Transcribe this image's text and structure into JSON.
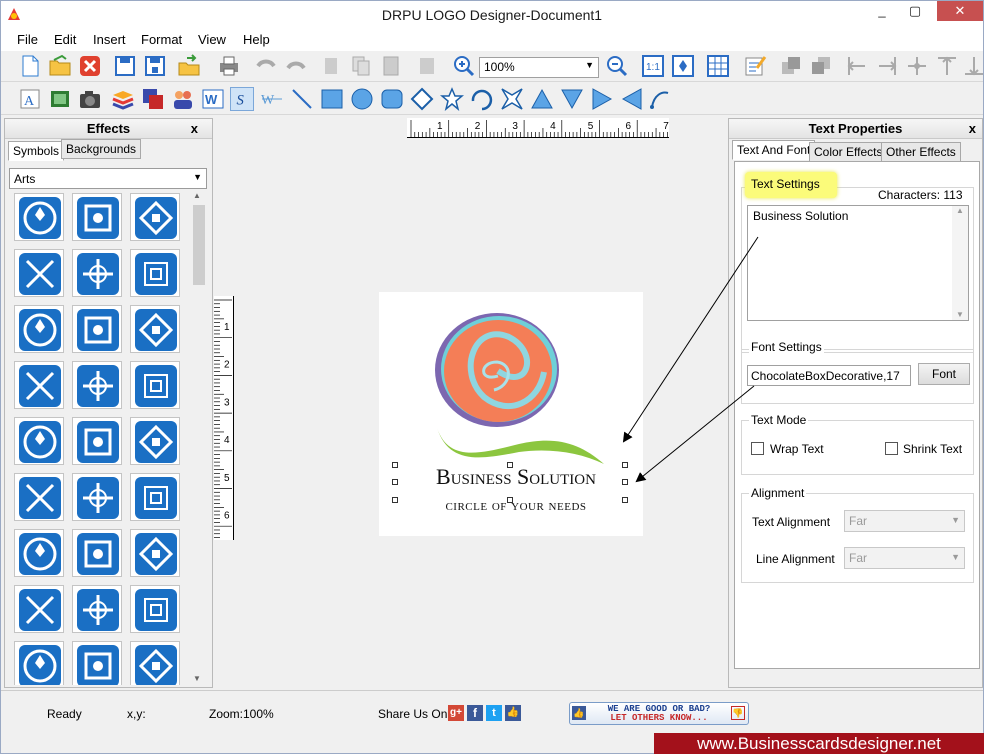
{
  "window": {
    "title": "DRPU LOGO Designer-Document1",
    "min": "_",
    "restore": "▢",
    "close": "✕"
  },
  "menu": [
    "File",
    "Edit",
    "Insert",
    "Format",
    "View",
    "Help"
  ],
  "toolbar": {
    "zoom_value": "100%"
  },
  "effects": {
    "title": "Effects",
    "close": "x",
    "tabs": [
      "Symbols",
      "Backgrounds"
    ],
    "category": "Arts"
  },
  "ruler": {
    "h_ticks": [
      "1",
      "2",
      "3",
      "4",
      "5",
      "6",
      "7"
    ],
    "v_ticks": [
      "1",
      "2",
      "3",
      "4",
      "5",
      "6"
    ]
  },
  "logo": {
    "line1": "Business Solution",
    "line2": "circle of your needs"
  },
  "text_properties": {
    "title": "Text Properties",
    "close": "x",
    "tabs": [
      "Text And Font",
      "Color Effects",
      "Other Effects"
    ],
    "text_settings_label": "Text Settings",
    "characters": "Characters: 113",
    "text_value": "Business Solution",
    "font_settings_label": "Font Settings",
    "font_value": "ChocolateBoxDecorative,17",
    "font_button": "Font",
    "text_mode_label": "Text Mode",
    "wrap_text": "Wrap Text",
    "shrink_text": "Shrink Text",
    "alignment_label": "Alignment",
    "text_alignment_label": "Text Alignment",
    "text_alignment_value": "Far",
    "line_alignment_label": "Line Alignment",
    "line_alignment_value": "Far"
  },
  "status": {
    "ready": "Ready",
    "coords": "x,y:",
    "zoom": "Zoom:100%",
    "share": "Share Us On:",
    "feedback_line1": "WE ARE GOOD OR BAD?",
    "feedback_line2": "LET OTHERS KNOW..."
  },
  "website": "www.Businesscardsdesigner.net",
  "colors": {
    "symbol_blue": "#1a6fc4",
    "highlight": "#fbfb7a",
    "logo_orange": "#f47e57",
    "logo_purple": "#7c67b0",
    "logo_teal": "#7ed8d8",
    "logo_green": "#8cc63f",
    "banner": "#a3111b"
  }
}
